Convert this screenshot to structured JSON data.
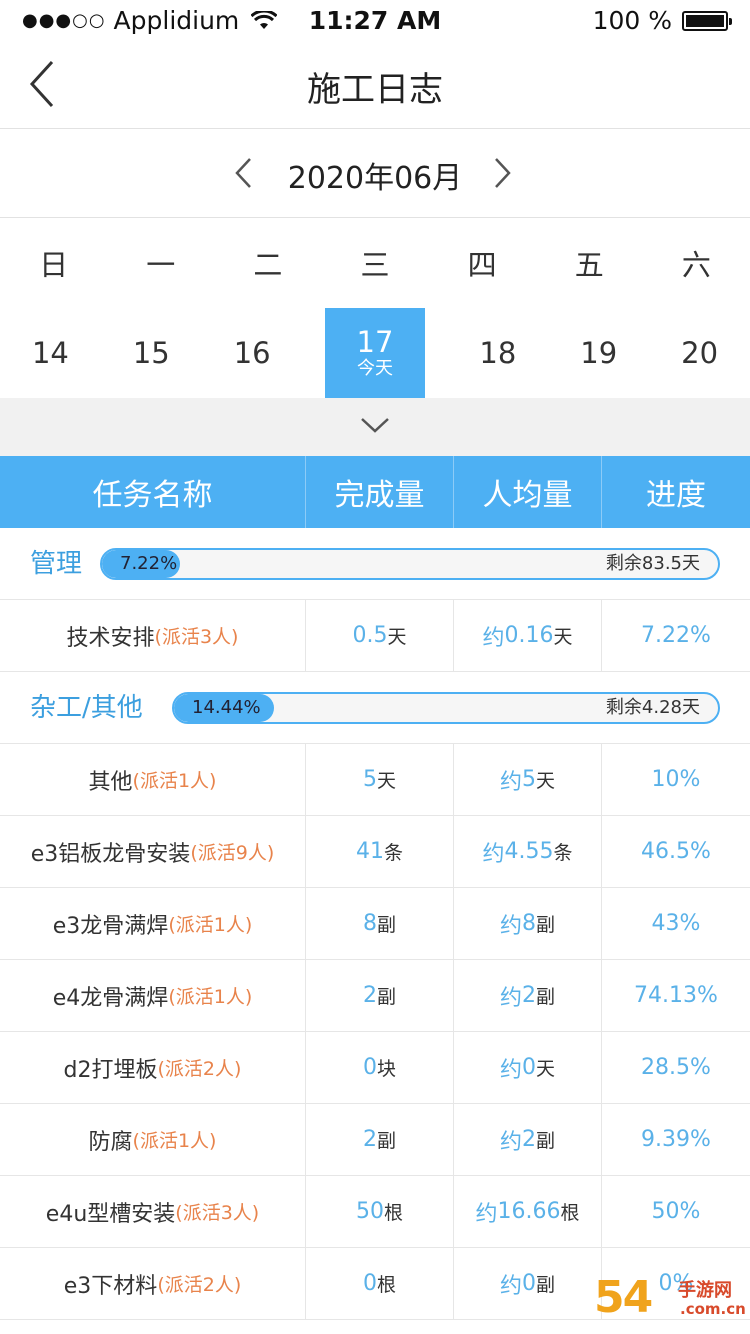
{
  "status_bar": {
    "signal": "●●●○○",
    "carrier": "Applidium",
    "time": "11:27 AM",
    "battery": "100 %"
  },
  "nav": {
    "title": "施工日志"
  },
  "month": {
    "label": "2020年06月"
  },
  "weekdays": [
    "日",
    "一",
    "二",
    "三",
    "四",
    "五",
    "六"
  ],
  "dates": [
    {
      "num": "14",
      "sub": ""
    },
    {
      "num": "15",
      "sub": ""
    },
    {
      "num": "16",
      "sub": ""
    },
    {
      "num": "17",
      "sub": "今天"
    },
    {
      "num": "18",
      "sub": ""
    },
    {
      "num": "19",
      "sub": ""
    },
    {
      "num": "20",
      "sub": ""
    }
  ],
  "selected_date_index": 3,
  "table": {
    "headers": [
      "任务名称",
      "完成量",
      "人均量",
      "进度"
    ],
    "groups": [
      {
        "name": "管理",
        "progress_label": "7.22%",
        "progress": 0.0722,
        "remain": "剩余83.5天",
        "rows": [
          {
            "name": "技术安排",
            "assign": "(派活3人)",
            "done_val": "0.5",
            "done_unit": "天",
            "avg_prefix": "约",
            "avg_val": "0.16",
            "avg_unit": "天",
            "pct": "7.22%"
          }
        ]
      },
      {
        "name": "杂工/其他",
        "progress_label": "14.44%",
        "progress": 0.1444,
        "remain": "剩余4.28天",
        "rows": [
          {
            "name": "其他",
            "assign": "(派活1人)",
            "done_val": "5",
            "done_unit": "天",
            "avg_prefix": "约",
            "avg_val": "5",
            "avg_unit": "天",
            "pct": "10%"
          },
          {
            "name": "e3铝板龙骨安装",
            "assign": "(派活9人)",
            "done_val": "41",
            "done_unit": "条",
            "avg_prefix": "约",
            "avg_val": "4.55",
            "avg_unit": "条",
            "pct": "46.5%"
          },
          {
            "name": "e3龙骨满焊",
            "assign": "(派活1人)",
            "done_val": "8",
            "done_unit": "副",
            "avg_prefix": "约",
            "avg_val": "8",
            "avg_unit": "副",
            "pct": "43%"
          },
          {
            "name": "e4龙骨满焊",
            "assign": "(派活1人)",
            "done_val": "2",
            "done_unit": "副",
            "avg_prefix": "约",
            "avg_val": "2",
            "avg_unit": "副",
            "pct": "74.13%"
          },
          {
            "name": "d2打埋板",
            "assign": "(派活2人)",
            "done_val": "0",
            "done_unit": "块",
            "avg_prefix": "约",
            "avg_val": "0",
            "avg_unit": "天",
            "pct": "28.5%"
          },
          {
            "name": "防腐",
            "assign": "(派活1人)",
            "done_val": "2",
            "done_unit": "副",
            "avg_prefix": "约",
            "avg_val": "2",
            "avg_unit": "副",
            "pct": "9.39%"
          },
          {
            "name": "e4u型槽安装",
            "assign": "(派活3人)",
            "done_val": "50",
            "done_unit": "根",
            "avg_prefix": "约",
            "avg_val": "16.66",
            "avg_unit": "根",
            "pct": "50%"
          },
          {
            "name": "e3下材料",
            "assign": "(派活2人)",
            "done_val": "0",
            "done_unit": "根",
            "avg_prefix": "约",
            "avg_val": "0",
            "avg_unit": "副",
            "pct": "0%"
          }
        ]
      }
    ]
  },
  "watermark": {
    "big": "54",
    "line1": "手游网",
    "line2": ".com.cn"
  },
  "colors": {
    "accent": "#4db0f3",
    "assign": "#e8834b",
    "value": "#5ab1e8"
  }
}
